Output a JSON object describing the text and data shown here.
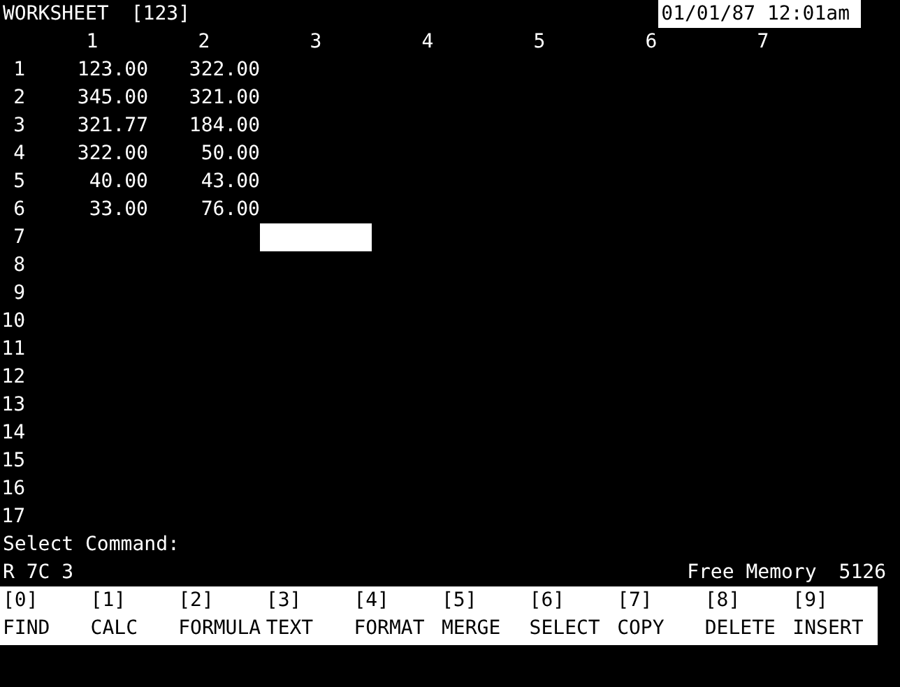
{
  "header": {
    "title": "WORKSHEET",
    "sheet": "[123]",
    "datetime": "01/01/87  12:01am"
  },
  "columns": [
    "1",
    "2",
    "3",
    "4",
    "5",
    "6",
    "7"
  ],
  "rows": [
    {
      "label": "1",
      "cells": [
        {
          "value": "123.00",
          "selected": false
        },
        {
          "value": "322.00",
          "selected": false
        }
      ]
    },
    {
      "label": "2",
      "cells": [
        {
          "value": "345.00",
          "selected": false
        },
        {
          "value": "321.00",
          "selected": false
        }
      ]
    },
    {
      "label": "3",
      "cells": [
        {
          "value": "321.77",
          "selected": false
        },
        {
          "value": "184.00",
          "selected": false
        }
      ]
    },
    {
      "label": "4",
      "cells": [
        {
          "value": "322.00",
          "selected": false
        },
        {
          "value": "50.00",
          "selected": false
        }
      ]
    },
    {
      "label": "5",
      "cells": [
        {
          "value": "40.00",
          "selected": false
        },
        {
          "value": "43.00",
          "selected": false
        }
      ]
    },
    {
      "label": "6",
      "cells": [
        {
          "value": "33.00",
          "selected": false
        },
        {
          "value": "76.00",
          "selected": false
        }
      ]
    },
    {
      "label": "7",
      "cells": [
        {
          "selected": false
        },
        {
          "selected": false
        },
        {
          "selected": true
        }
      ]
    },
    {
      "label": "8"
    },
    {
      "label": "9"
    },
    {
      "label": "10"
    },
    {
      "label": "11"
    },
    {
      "label": "12"
    },
    {
      "label": "13"
    },
    {
      "label": "14"
    },
    {
      "label": "15"
    },
    {
      "label": "16"
    },
    {
      "label": "17"
    }
  ],
  "prompt": "Select Command:",
  "status_bar": {
    "position": "R 7C 3",
    "memory_label": "Free Memory",
    "memory_value": "5126"
  },
  "function_keys": [
    {
      "key": "[0]",
      "label": "FIND"
    },
    {
      "key": "[1]",
      "label": "CALC"
    },
    {
      "key": "[2]",
      "label": "FORMULA"
    },
    {
      "key": "[3]",
      "label": "TEXT"
    },
    {
      "key": "[4]",
      "label": "FORMAT"
    },
    {
      "key": "[5]",
      "label": "MERGE"
    },
    {
      "key": "[6]",
      "label": "SELECT"
    },
    {
      "key": "[7]",
      "label": "COPY"
    },
    {
      "key": "[8]",
      "label": "DELETE"
    },
    {
      "key": "[9]",
      "label": "INSERT"
    }
  ]
}
